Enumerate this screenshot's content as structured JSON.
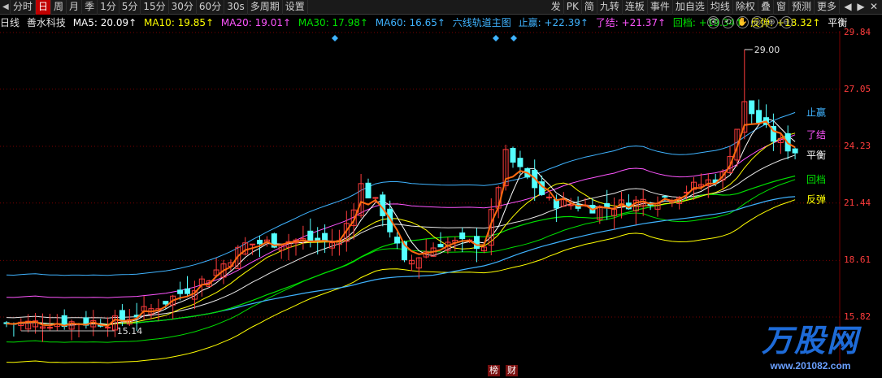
{
  "toolbar": {
    "left_items": [
      "分时",
      "日",
      "周",
      "月",
      "季",
      "1分",
      "5分",
      "15分",
      "30分",
      "60分",
      "30s",
      "多周期",
      "设置"
    ],
    "active": "日",
    "right_items": [
      "发",
      "PK",
      "简",
      "九转",
      "连板",
      "事件",
      "加自选",
      "均线",
      "除权",
      "叠",
      "窗",
      "预测",
      "更多"
    ],
    "window_controls": [
      "◀",
      "▶",
      "✕"
    ]
  },
  "info": {
    "period": "日线",
    "name": "善水科技",
    "ma5": "MA5: 20.09↑",
    "ma10": "MA10: 19.85↑",
    "ma20": "MA20: 19.01↑",
    "ma30": "MA30: 17.98↑",
    "ma60": "MA60: 16.65↑",
    "indicator": "六线轨道主图",
    "zhiying": "止赢: +22.39↑",
    "liaojie": "了结: +21.37↑",
    "huidang": "回档: +19.34↑",
    "fantan": "反弹: +18.32↑",
    "pingheng": "平衡"
  },
  "colors": {
    "up": "#ff3c3c",
    "down": "#54ffff",
    "ma5": "#ffffff",
    "ma10": "#ffff00",
    "ma20": "#ff55ff",
    "ma30": "#00e000",
    "ma60": "#3fb3ff",
    "orange": "#ff6a10",
    "grid": "#7a0000"
  },
  "price_scale": [
    "29.84",
    "27.05",
    "24.23",
    "21.44",
    "18.61",
    "15.82"
  ],
  "annotations": {
    "high": "29.00",
    "low": "15.14"
  },
  "track_labels": [
    "止赢",
    "了结",
    "平衡",
    "回档",
    "反弹"
  ],
  "bottom_marks": [
    "榜",
    "财"
  ],
  "watermark": {
    "brand": "万股网",
    "url": "www.201082.com"
  },
  "tools": [
    "👁",
    "⟲",
    "✋",
    "◎",
    "⊕",
    "⊖"
  ]
}
